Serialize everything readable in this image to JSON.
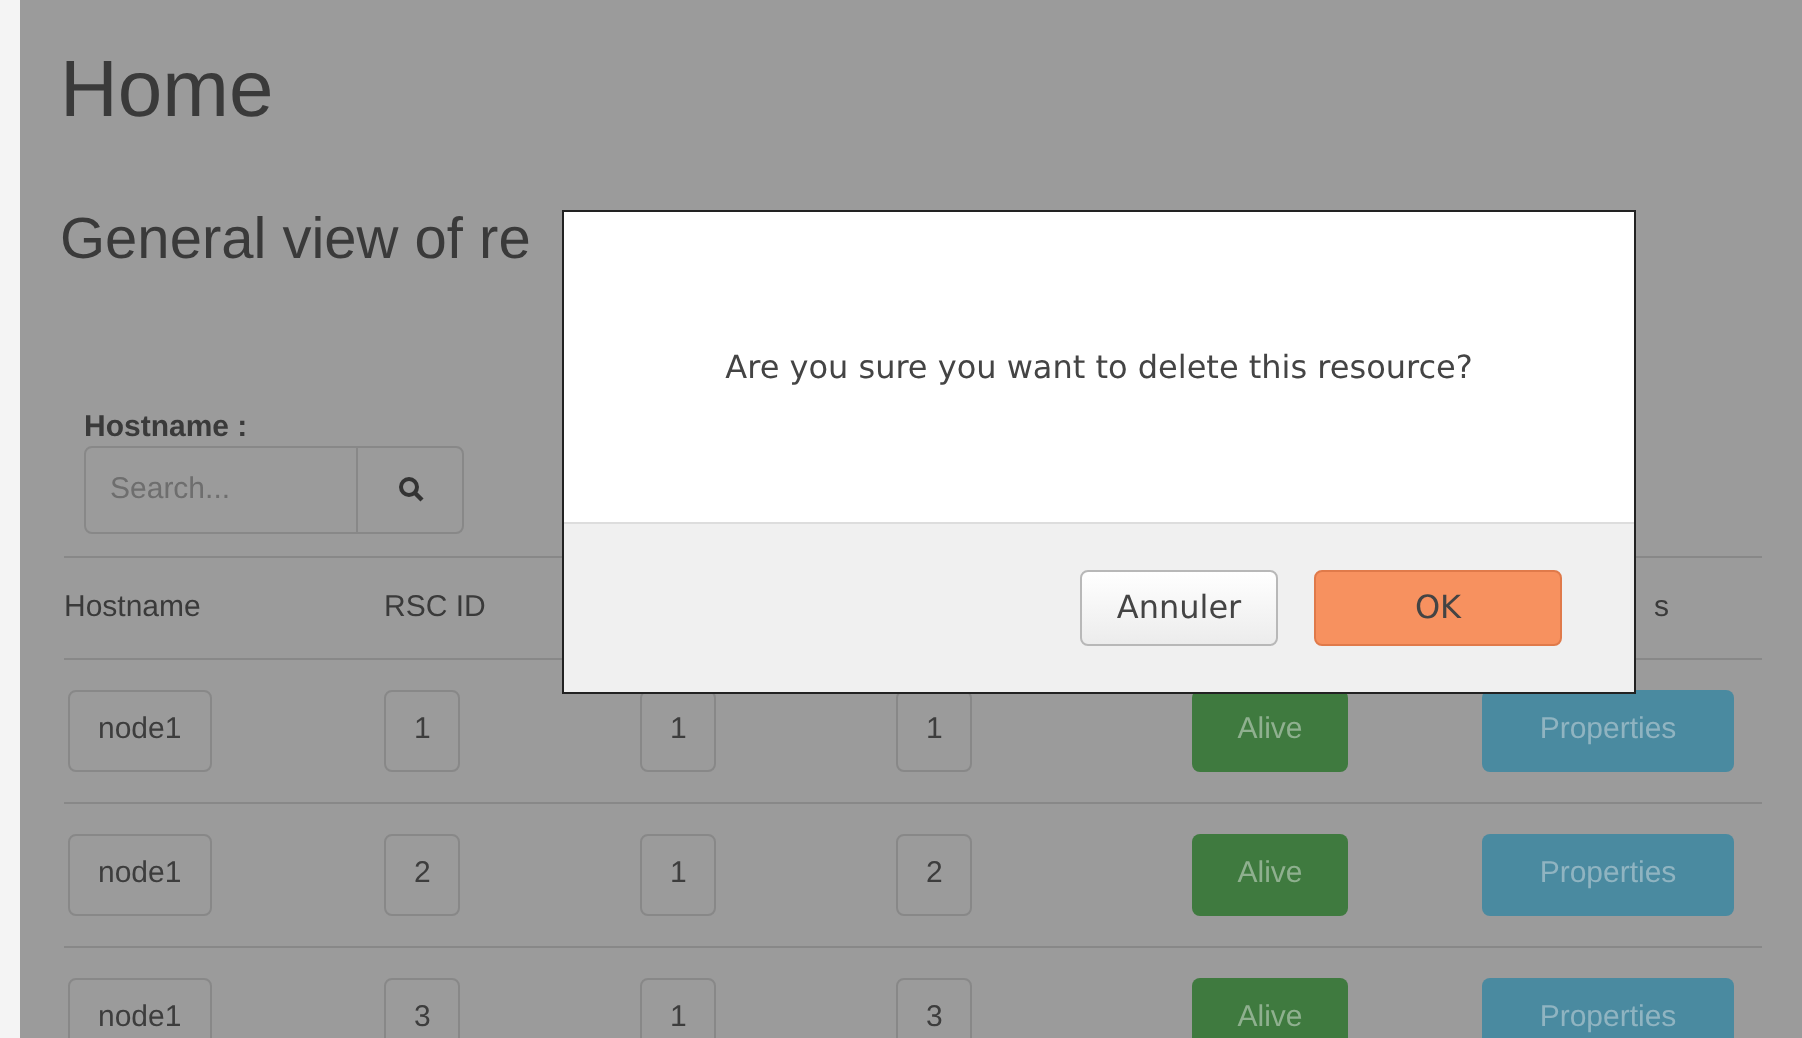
{
  "page": {
    "title": "Home",
    "subtitle": "General view of re"
  },
  "filter": {
    "label": "Hostname :",
    "placeholder": "Search..."
  },
  "table": {
    "columns": [
      "Hostname",
      "RSC ID"
    ],
    "last_column_fragment": "s",
    "rows": [
      {
        "hostname": "node1",
        "rsc_id": "1",
        "column_3": "1",
        "column_4": "1",
        "status": "Alive",
        "action": "Properties"
      },
      {
        "hostname": "node1",
        "rsc_id": "2",
        "column_3": "1",
        "column_4": "2",
        "status": "Alive",
        "action": "Properties"
      },
      {
        "hostname": "node1",
        "rsc_id": "3",
        "column_3": "1",
        "column_4": "3",
        "status": "Alive",
        "action": "Properties"
      }
    ]
  },
  "dialog": {
    "message": "Are you sure you want to delete this resource?",
    "buttons": [
      {
        "label": "Annuler",
        "kind": "cancel"
      },
      {
        "label": "OK",
        "kind": "confirm"
      }
    ]
  }
}
